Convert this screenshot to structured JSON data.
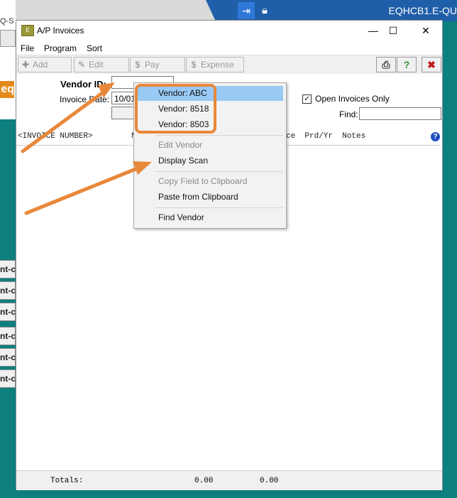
{
  "background": {
    "partial_label": "Q-S",
    "logo_fragment": "eq",
    "title_fragment": "EQHCB1.E-QU",
    "side_button_label": "nt-cl",
    "side_button_count": 6
  },
  "dialog": {
    "icon_text": "E",
    "title": "A/P Invoices",
    "controls": {
      "minimize": "—",
      "maximize": "☐",
      "close": "✕"
    }
  },
  "menu": {
    "items": [
      "File",
      "Program",
      "Sort"
    ]
  },
  "toolbar": {
    "add_label": "Add",
    "edit_label": "Edit",
    "pay_label": "Pay",
    "expense_label": "Expense",
    "print_icon": "printer-icon",
    "help_icon": "help-icon",
    "close_icon": "close-icon"
  },
  "form": {
    "vendor_id_label": "Vendor ID:",
    "vendor_id_value": "",
    "invoice_date_label": "Invoice Date:",
    "invoice_date_value": "10/01",
    "open_only_label": "Open Invoices Only",
    "open_only_checked": true,
    "find_label": "Find:",
    "find_value": ""
  },
  "grid": {
    "header_left": "<INVOICE NUMBER>",
    "header_left_cut": "N",
    "header_right": "ce  Prd/Yr  Notes"
  },
  "totals": {
    "label": "Totals:",
    "value1": "0.00",
    "value2": "0.00"
  },
  "context_menu": {
    "items": [
      {
        "label": "Vendor: ABC",
        "enabled": true,
        "highlighted": true
      },
      {
        "label": "Vendor: 8518",
        "enabled": true
      },
      {
        "label": "Vendor: 8503",
        "enabled": true
      },
      {
        "label": "Edit Vendor",
        "enabled": false
      },
      {
        "label": "Display Scan",
        "enabled": true
      },
      {
        "label": "Copy Field to Clipboard",
        "enabled": false
      },
      {
        "label": "Paste from Clipboard",
        "enabled": true
      },
      {
        "label": "Find Vendor",
        "enabled": true
      }
    ]
  },
  "colors": {
    "teal_background": "#0d7f7f",
    "annotation_orange": "#e8883a",
    "highlight_blue": "#99c9f5",
    "title_band": "#1f5ea8",
    "close_red": "#c0181c",
    "help_green": "#2f8f2f"
  }
}
